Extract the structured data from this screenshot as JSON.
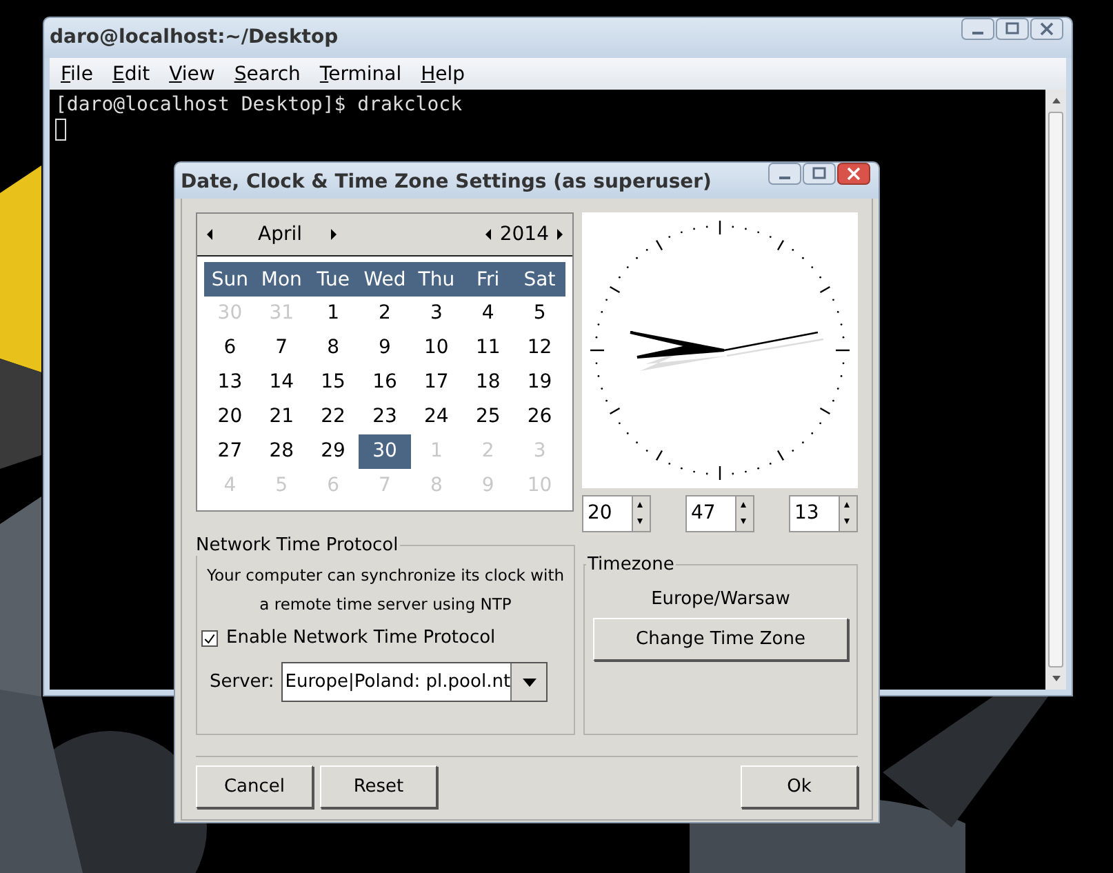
{
  "terminal": {
    "title": "daro@localhost:~/Desktop",
    "menu": [
      "File",
      "Edit",
      "View",
      "Search",
      "Terminal",
      "Help"
    ],
    "lines": [
      "[daro@localhost Desktop]$ drakclock"
    ]
  },
  "dialog": {
    "title": "Date, Clock & Time Zone Settings (as superuser)",
    "calendar": {
      "month": "April",
      "year": "2014",
      "weekdays": [
        "Sun",
        "Mon",
        "Tue",
        "Wed",
        "Thu",
        "Fri",
        "Sat"
      ],
      "weeks": [
        [
          {
            "label": "30",
            "other_month": true,
            "selected": false
          },
          {
            "label": "31",
            "other_month": true,
            "selected": false
          },
          {
            "label": "1",
            "other_month": false,
            "selected": false
          },
          {
            "label": "2",
            "other_month": false,
            "selected": false
          },
          {
            "label": "3",
            "other_month": false,
            "selected": false
          },
          {
            "label": "4",
            "other_month": false,
            "selected": false
          },
          {
            "label": "5",
            "other_month": false,
            "selected": false
          }
        ],
        [
          {
            "label": "6",
            "other_month": false,
            "selected": false
          },
          {
            "label": "7",
            "other_month": false,
            "selected": false
          },
          {
            "label": "8",
            "other_month": false,
            "selected": false
          },
          {
            "label": "9",
            "other_month": false,
            "selected": false
          },
          {
            "label": "10",
            "other_month": false,
            "selected": false
          },
          {
            "label": "11",
            "other_month": false,
            "selected": false
          },
          {
            "label": "12",
            "other_month": false,
            "selected": false
          }
        ],
        [
          {
            "label": "13",
            "other_month": false,
            "selected": false
          },
          {
            "label": "14",
            "other_month": false,
            "selected": false
          },
          {
            "label": "15",
            "other_month": false,
            "selected": false
          },
          {
            "label": "16",
            "other_month": false,
            "selected": false
          },
          {
            "label": "17",
            "other_month": false,
            "selected": false
          },
          {
            "label": "18",
            "other_month": false,
            "selected": false
          },
          {
            "label": "19",
            "other_month": false,
            "selected": false
          }
        ],
        [
          {
            "label": "20",
            "other_month": false,
            "selected": false
          },
          {
            "label": "21",
            "other_month": false,
            "selected": false
          },
          {
            "label": "22",
            "other_month": false,
            "selected": false
          },
          {
            "label": "23",
            "other_month": false,
            "selected": false
          },
          {
            "label": "24",
            "other_month": false,
            "selected": false
          },
          {
            "label": "25",
            "other_month": false,
            "selected": false
          },
          {
            "label": "26",
            "other_month": false,
            "selected": false
          }
        ],
        [
          {
            "label": "27",
            "other_month": false,
            "selected": false
          },
          {
            "label": "28",
            "other_month": false,
            "selected": false
          },
          {
            "label": "29",
            "other_month": false,
            "selected": false
          },
          {
            "label": "30",
            "other_month": false,
            "selected": true
          },
          {
            "label": "1",
            "other_month": true,
            "selected": false
          },
          {
            "label": "2",
            "other_month": true,
            "selected": false
          },
          {
            "label": "3",
            "other_month": true,
            "selected": false
          }
        ],
        [
          {
            "label": "4",
            "other_month": true,
            "selected": false
          },
          {
            "label": "5",
            "other_month": true,
            "selected": false
          },
          {
            "label": "6",
            "other_month": true,
            "selected": false
          },
          {
            "label": "7",
            "other_month": true,
            "selected": false
          },
          {
            "label": "8",
            "other_month": true,
            "selected": false
          },
          {
            "label": "9",
            "other_month": true,
            "selected": false
          },
          {
            "label": "10",
            "other_month": true,
            "selected": false
          }
        ]
      ]
    },
    "time": {
      "hour": "20",
      "minute": "47",
      "second": "13"
    },
    "ntp": {
      "title": "Network Time Protocol",
      "description": "Your computer can synchronize its clock with a remote time server using NTP",
      "enable_label": "Enable Network Time Protocol",
      "checked": true,
      "server_label": "Server:",
      "server": "Europe|Poland: pl.pool.nt"
    },
    "timezone": {
      "title": "Timezone",
      "zone": "Europe/Warsaw",
      "button": "Change Time Zone"
    },
    "buttons": {
      "cancel": "Cancel",
      "reset": "Reset",
      "ok": "Ok"
    }
  }
}
